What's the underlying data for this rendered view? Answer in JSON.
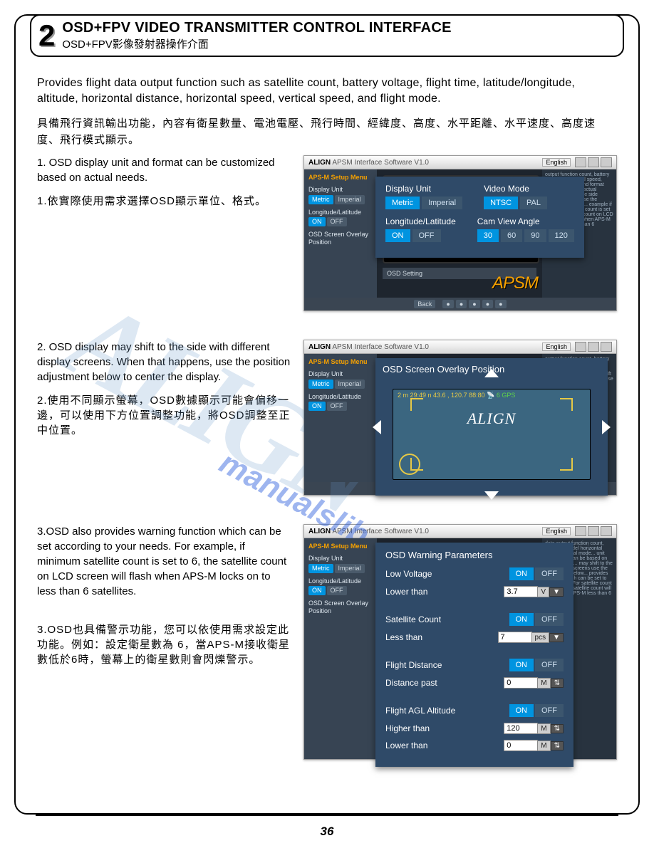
{
  "section": {
    "number": "2",
    "title_en": "OSD+FPV VIDEO TRANSMITTER CONTROL INTERFACE",
    "title_zh": "OSD+FPV影像發射器操作介面"
  },
  "intro_en": "Provides flight data output function such as satellite count, battery voltage, flight time, latitude/longitude, altitude, horizontal distance, horizontal speed, vertical speed, and flight mode.",
  "intro_zh": "具備飛行資訊輸出功能，內容有衛星數量、電池電壓、飛行時間、經緯度、高度、水平距離、水平速度、高度速度、飛行模式顯示。",
  "item1": {
    "en": "1. OSD display unit and format can be customized based on actual needs.",
    "zh": "1.依實際使用需求選擇OSD顯示單位、格式。"
  },
  "item2": {
    "en": "2. OSD display may shift to the side with different display screens.  When that happens, use the position adjustment below to center the display.",
    "zh": "2.使用不同顯示螢幕，OSD數據顯示可能會偏移一邊，可以使用下方位置調整功能，將OSD調整至正中位置。"
  },
  "item3": {
    "en": "3.OSD also provides warning function which can be set according to your needs.  For example, if minimum satellite count is set to 6, the satellite count on LCD screen will flash when APS-M locks on to less than 6 satellites.",
    "zh": "3.OSD也具備警示功能，您可以依使用需求設定此功能。例如：設定衛星數為 6，當APS-M接收衛星數低於6時，螢幕上的衛星數則會閃爍警示。"
  },
  "app": {
    "brand": "ALIGN",
    "software": "APSM Interface Software  V1.0",
    "lang": "English",
    "sidebar_label": "APS-M Setup Menu",
    "apsm": "APSM",
    "side": {
      "display_unit": "Display Unit",
      "metric": "Metric",
      "imperial": "Imperial",
      "longlat": "Longitude/Latitude",
      "on": "ON",
      "off": "OFF",
      "osd_overlay": "OSD Screen Overlay Position"
    },
    "osd_setting": "OSD Setting",
    "back": "Back"
  },
  "popup1": {
    "display_unit": "Display Unit",
    "metric": "Metric",
    "imperial": "Imperial",
    "video_mode": "Video Mode",
    "ntsc": "NTSC",
    "pal": "PAL",
    "longlat": "Longitude/Latitude",
    "on": "ON",
    "off": "OFF",
    "cam_view": "Cam View Angle",
    "a30": "30",
    "a60": "60",
    "a90": "90",
    "a120": "120"
  },
  "popup2": {
    "title": "OSD Screen Overlay Position",
    "overlay_text": "2 m 29:49 n 43.6 , 120.7 88:80",
    "gps": "6 GPS",
    "align": "ALIGN"
  },
  "popup3": {
    "title": "OSD Warning Parameters",
    "low_voltage": "Low Voltage",
    "lower_than": "Lower than",
    "lv_val": "3.7",
    "lv_unit": "V",
    "sat_count": "Satellite Count",
    "less_than": "Less than",
    "sc_val": "7",
    "sc_unit": "pcs",
    "flight_distance": "Flight Distance",
    "distance_past": "Distance past",
    "fd_val": "0",
    "fd_unit": "M",
    "flight_agl": "Flight AGL Altitude",
    "higher_than": "Higher than",
    "ht_val": "120",
    "ht_unit": "M",
    "lower_than2": "Lower than",
    "lt_val": "0",
    "lt_unit": "M",
    "on": "ON",
    "off": "OFF"
  },
  "monitor": {
    "flight_agl": "Flight AGL Altitude",
    "higher_than": "Higher than",
    "lower_than": "Lower than",
    "v120": "120",
    "v0": "0"
  },
  "page_number": "36"
}
